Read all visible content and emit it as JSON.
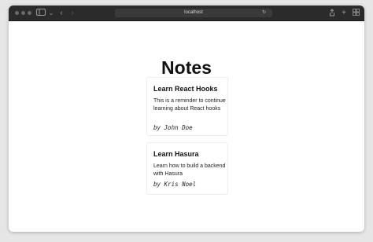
{
  "browser": {
    "url": "localhost",
    "sidebar_icon": "sidebar-icon",
    "back_icon": "chevron-left-icon",
    "forward_icon": "chevron-right-icon",
    "reload_icon": "reload-icon",
    "share_icon": "share-icon",
    "new_tab_icon": "plus-icon",
    "tabs_icon": "tab-overview-icon"
  },
  "page": {
    "title": "Notes",
    "notes": [
      {
        "title": "Learn React Hooks",
        "body": "This is a reminder to continue learning about React hooks",
        "author": "by John Doe"
      },
      {
        "title": "Learn Hasura",
        "body": "Learn how to build a backend with Hasura",
        "author": "by Kris Noel"
      }
    ]
  }
}
